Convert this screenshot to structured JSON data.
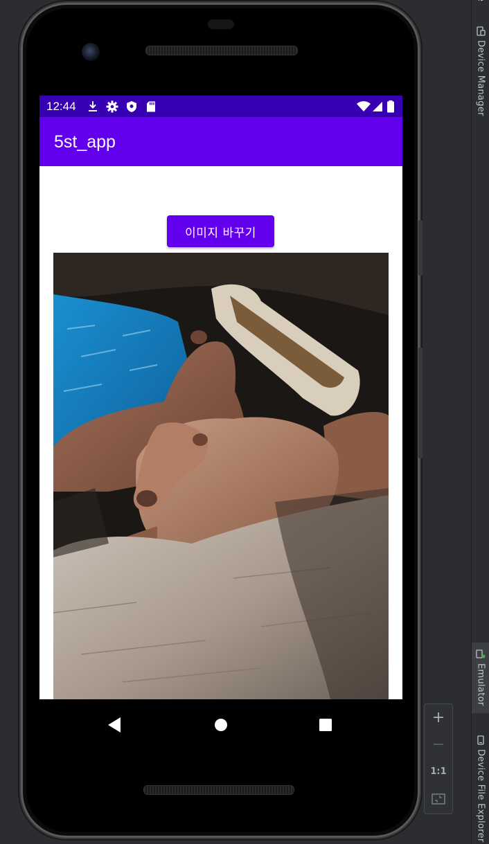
{
  "status_bar": {
    "time": "12:44",
    "left_icons": [
      "download-icon",
      "settings-icon",
      "shield-icon",
      "sd-card-icon"
    ],
    "right_icons": [
      "wifi-icon",
      "signal-icon",
      "battery-icon"
    ],
    "color": "#3700b3"
  },
  "app_bar": {
    "title": "5st_app",
    "color": "#6200ee"
  },
  "main": {
    "change_image_button_label": "이미지 바꾸기",
    "image_subject": "capybaras"
  },
  "nav_bar": {
    "buttons": [
      "back-icon",
      "home-icon",
      "recents-icon"
    ]
  },
  "ide_tool_strip": {
    "device_manager_label": "Device Manager",
    "emulator_label": "Emulator",
    "device_file_explorer_label": "Device File Explorer"
  },
  "zoom_controls": {
    "zoom_in_label": "+",
    "zoom_out_label": "−",
    "actual_size_label": "1:1"
  }
}
